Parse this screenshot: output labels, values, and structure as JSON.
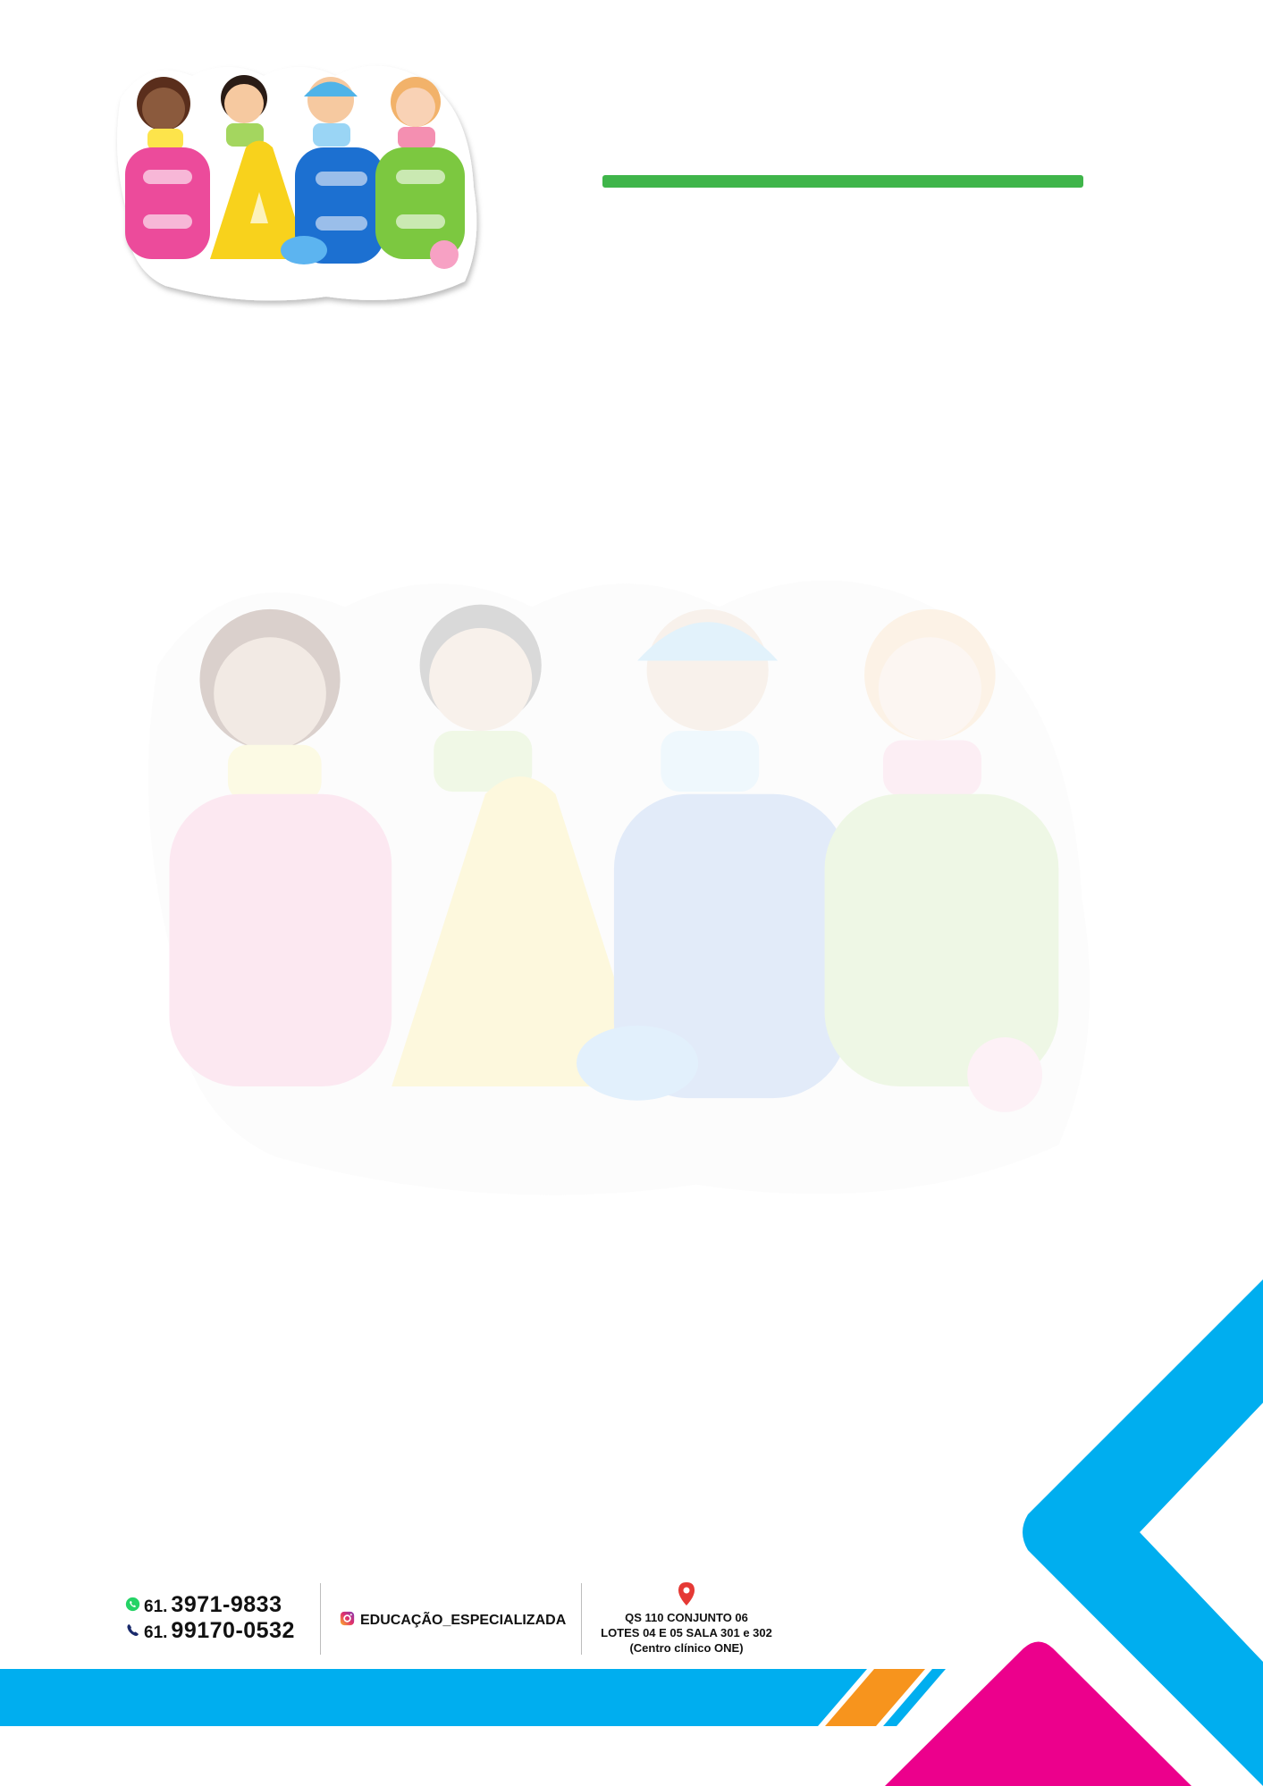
{
  "logo": {
    "text": "EAEE",
    "icon": "children-logo"
  },
  "watermark": {
    "text": "EAEE",
    "icon": "children-logo-watermark"
  },
  "contact": {
    "whatsapp": {
      "icon": "whatsapp-icon",
      "prefix": "61.",
      "number": "3971-9833"
    },
    "phone": {
      "icon": "phone-icon",
      "prefix": "61.",
      "number": "99170-0532"
    },
    "instagram": {
      "icon": "instagram-icon",
      "handle": "EDUCAÇÃO_ESPECIALIZADA"
    },
    "address": {
      "icon": "location-pin-icon",
      "line1": "QS 110 CONJUNTO 06",
      "line2": "LOTES 04 E 05 SALA 301 e 302",
      "line3": "(Centro clínico ONE)"
    }
  },
  "colors": {
    "green_rule": "#3fb54a",
    "blue": "#00aeef",
    "orange": "#f7941d",
    "magenta": "#ec008c"
  }
}
